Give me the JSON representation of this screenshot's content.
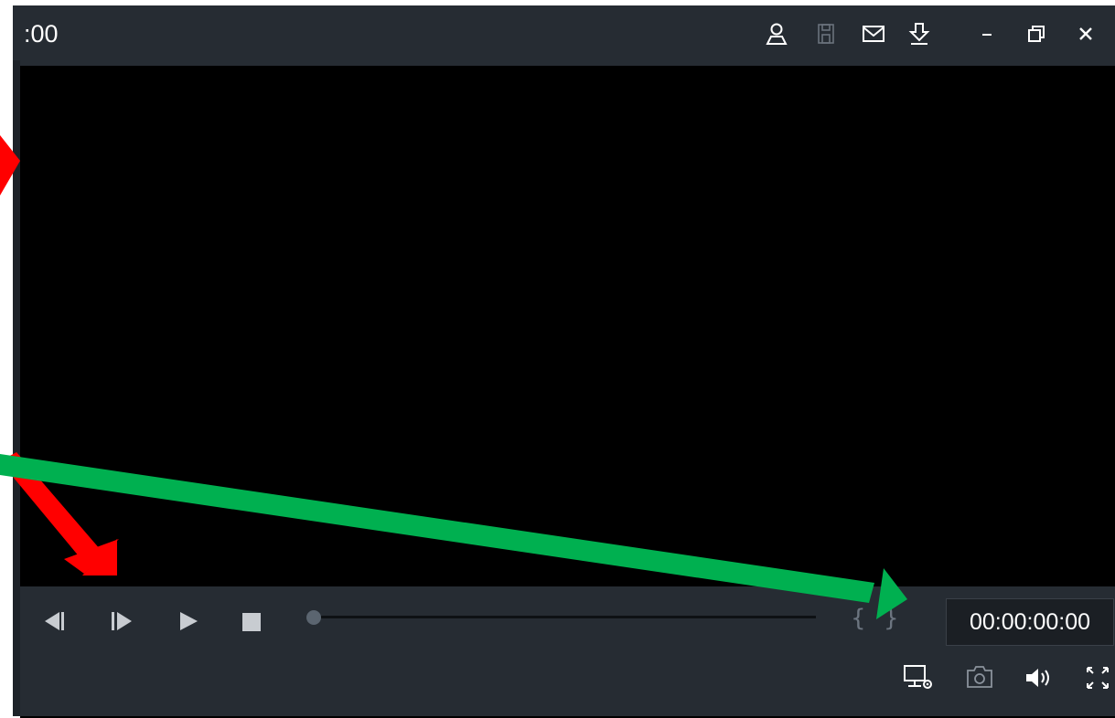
{
  "window": {
    "title": ":00",
    "toolbar_icons": [
      "user-icon",
      "save-icon",
      "mail-icon",
      "download-icon",
      "minimize-icon",
      "restore-icon",
      "close-icon"
    ]
  },
  "player": {
    "timecode": "00:00:00:00",
    "progress": 0,
    "mark_in": "{",
    "mark_out": "}",
    "controls": [
      "step-back-icon",
      "step-forward-icon",
      "play-icon",
      "stop-icon"
    ],
    "bottom_icons": [
      "display-settings-icon",
      "snapshot-icon",
      "volume-icon",
      "fullscreen-icon"
    ]
  },
  "annotations": {
    "arrow_colors": {
      "red": "#ff0000",
      "green": "#00b050"
    }
  }
}
